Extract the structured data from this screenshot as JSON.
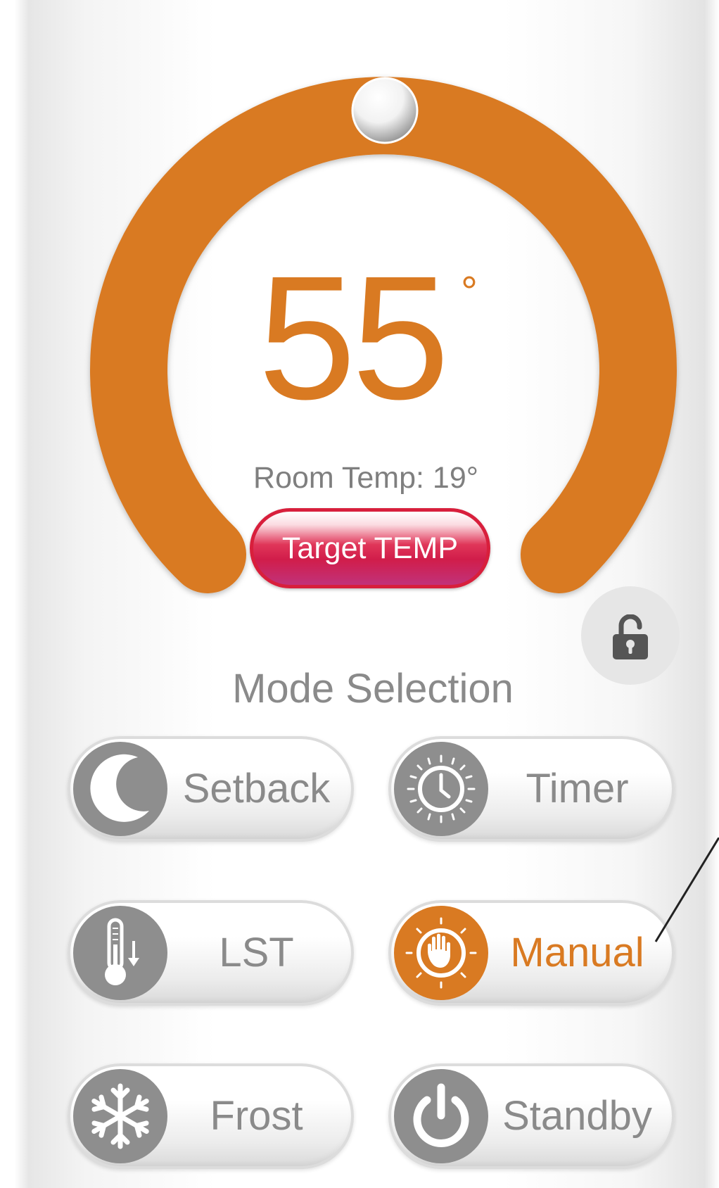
{
  "thermostat": {
    "target_temperature": "55",
    "degree_symbol": "°",
    "room_temp_text": "Room Temp: 19°",
    "target_button_label": "Target TEMP",
    "accent_color": "#d97a22",
    "target_button_color": "#d11d4a"
  },
  "lock": {
    "icon": "unlocked-padlock-icon"
  },
  "modes": {
    "title": "Mode Selection",
    "selected": "Manual",
    "items": [
      {
        "label": "Setback",
        "icon": "moon-icon"
      },
      {
        "label": "Timer",
        "icon": "clock-icon"
      },
      {
        "label": "LST",
        "icon": "thermometer-down-icon"
      },
      {
        "label": "Manual",
        "icon": "hand-icon"
      },
      {
        "label": "Frost",
        "icon": "snowflake-icon"
      },
      {
        "label": "Standby",
        "icon": "power-icon"
      }
    ]
  }
}
